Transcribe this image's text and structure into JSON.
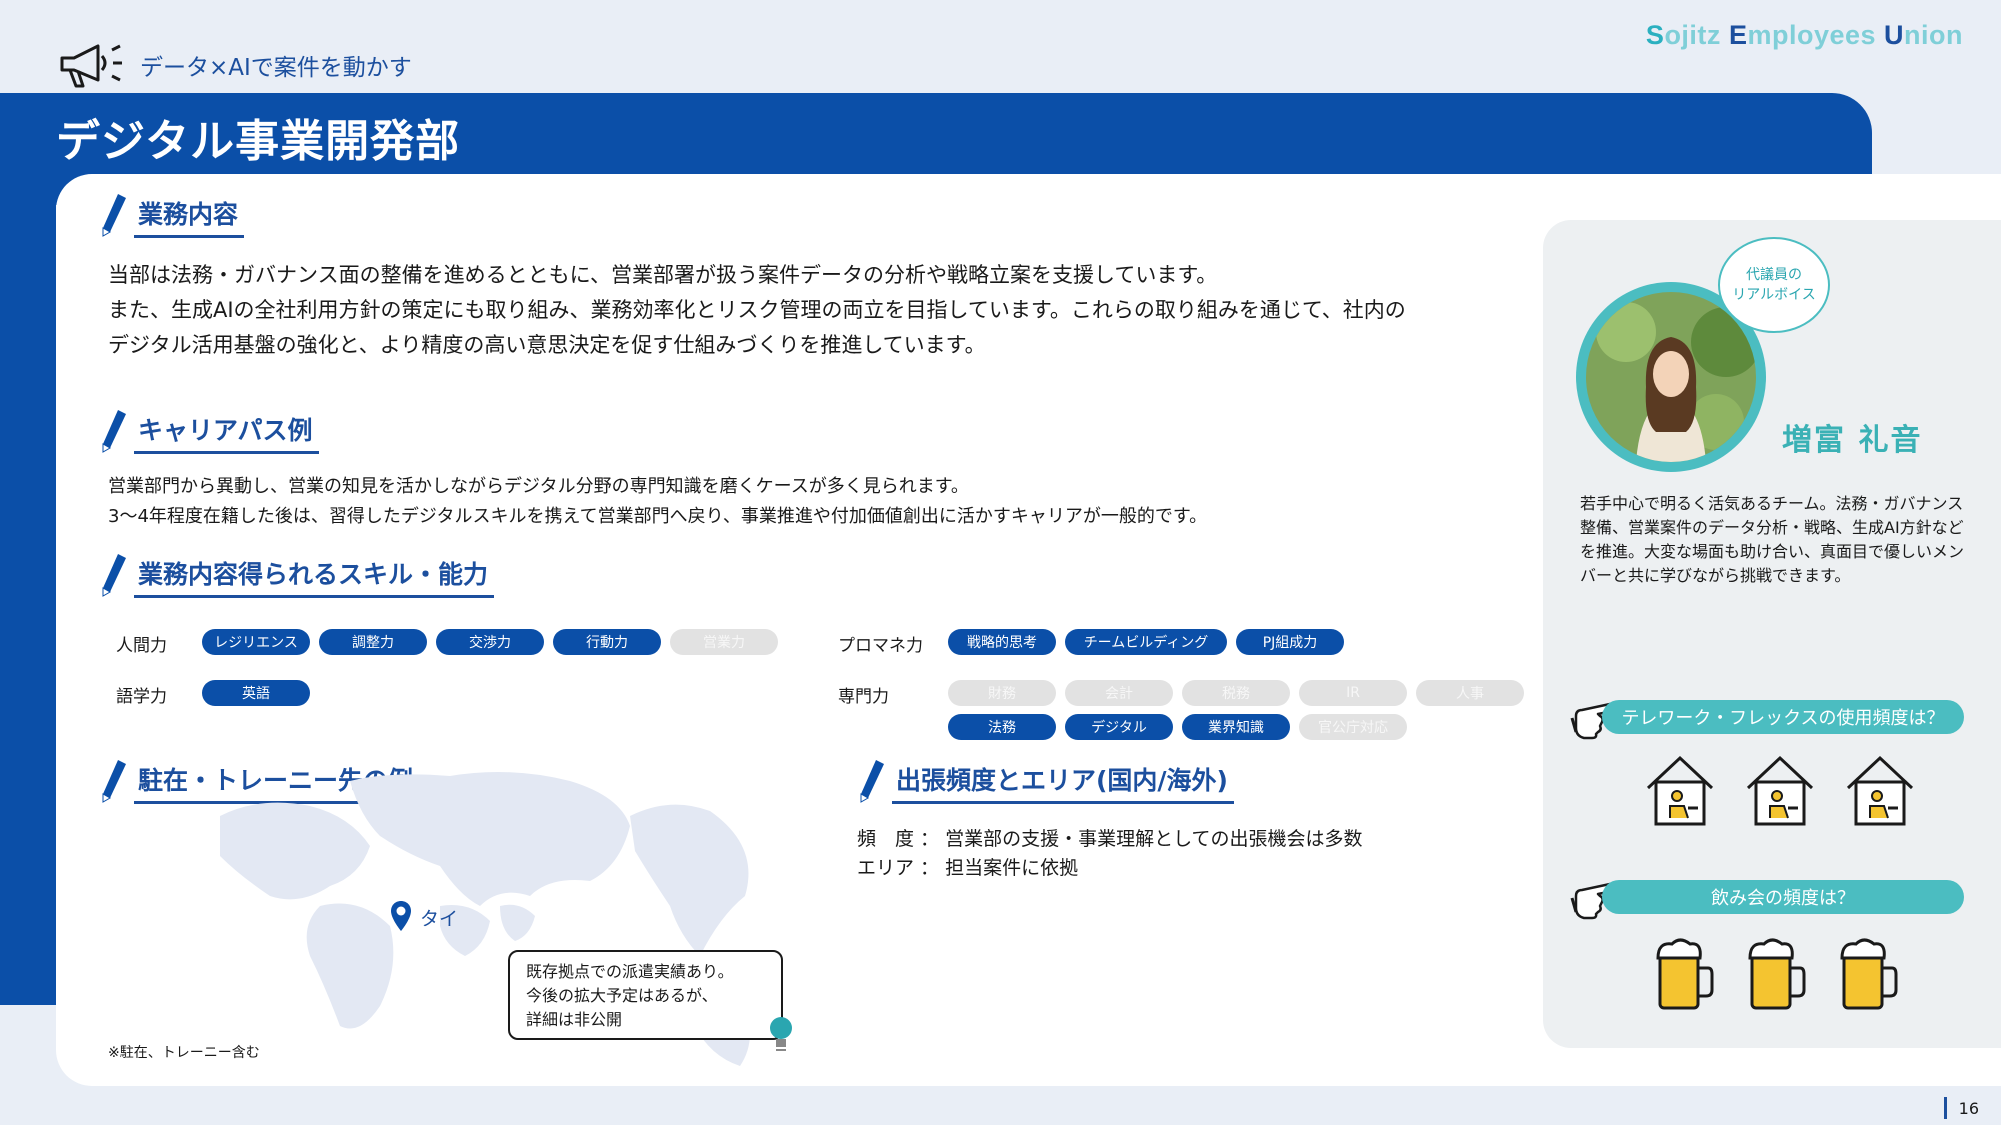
{
  "brand": {
    "p1": "S",
    "p2": "ojitz ",
    "p3": "E",
    "p4": "mployees ",
    "p5": "U",
    "p6": "nion"
  },
  "header": {
    "subtitle": "データ×AIで案件を動かす",
    "title": "デジタル事業開発部"
  },
  "business": {
    "heading": "業務内容",
    "lines": [
      "当部は法務・ガバナンス面の整備を進めるとともに、営業部署が扱う案件データの分析や戦略立案を支援しています。",
      "また、生成AIの全社利用方針の策定にも取り組み、業務効率化とリスク管理の両立を目指しています。これらの取り組みを通じて、社内の",
      "デジタル活用基盤の強化と、より精度の高い意思決定を促す仕組みづくりを推進しています。"
    ]
  },
  "career": {
    "heading": "キャリアパス例",
    "lines": [
      "営業部門から異動し、営業の知見を活かしながらデジタル分野の専門知識を磨くケースが多く見られます。",
      "3～4年程度在籍した後は、習得したデジタルスキルを携えて営業部門へ戻り、事業推進や付加価値創出に活かすキャリアが一般的です。"
    ]
  },
  "skills": {
    "heading": "業務内容得られるスキル・能力",
    "human": {
      "label": "人間力",
      "chips": [
        "レジリエンス",
        "調整力",
        "交渉力",
        "行動力",
        "営業力"
      ]
    },
    "pm": {
      "label": "プロマネ力",
      "chips": [
        "戦略的思考",
        "チームビルディング",
        "PJ組成力"
      ]
    },
    "lang": {
      "label": "語学力",
      "chips": [
        "英語"
      ]
    },
    "expert": {
      "label": "専門力",
      "row1": [
        "財務",
        "会計",
        "税務",
        "IR",
        "人事"
      ],
      "row2": [
        "法務",
        "デジタル",
        "業界知識",
        "官公庁対応"
      ]
    }
  },
  "posting": {
    "heading": "駐在・トレーニー先の例",
    "pin": "タイ",
    "callout": [
      "既存拠点での派遣実績あり。",
      "今後の拡大予定はあるが、",
      "詳細は非公開"
    ],
    "note": "※駐在、トレーニー含む"
  },
  "trip": {
    "heading": "出張頻度とエリア(国内/海外)",
    "lines": [
      "頻　度 ： 営業部の支援・事業理解としての出張機会は多数",
      "エリア ： 担当案件に依拠"
    ]
  },
  "voice": {
    "bubble": [
      "代議員の",
      "リアルボイス"
    ],
    "name": "増富 礼音",
    "lines": [
      "若手中心で明るく活気あるチーム。法務・ガバナンス",
      "整備、営業案件のデータ分析・戦略、生成AI方針など",
      "を推進。大変な場面も助け合い、真面目で優しいメン",
      "バーと共に学びながら挑戦できます。"
    ],
    "q1": "テレワーク・フレックスの使用頻度は？",
    "q2": "飲み会の頻度は？"
  },
  "page": "16",
  "colors": {
    "navy": "#0b4fa8",
    "teal": "#4bbdc1",
    "chip_off": "#e2e2e2"
  }
}
